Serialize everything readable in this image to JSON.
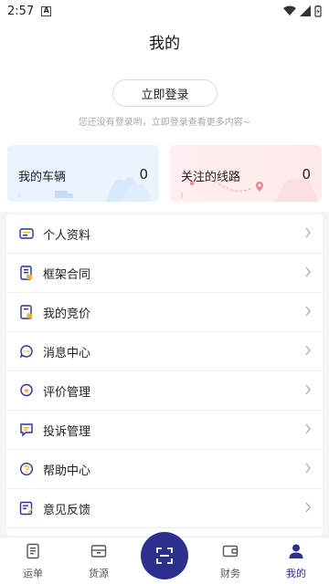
{
  "status_bar": {
    "time": "2:57",
    "notification_icon": "A"
  },
  "header": {
    "title": "我的"
  },
  "login": {
    "button_label": "立即登录",
    "hint": "您还没有登录哟，立即登录查看更多内容~"
  },
  "stats": {
    "vehicles": {
      "label": "我的车辆",
      "count": "0"
    },
    "routes": {
      "label": "关注的线路",
      "count": "0"
    }
  },
  "menu": [
    {
      "label": "个人资料",
      "icon": "id-card-icon"
    },
    {
      "label": "框架合同",
      "icon": "contract-icon"
    },
    {
      "label": "我的竞价",
      "icon": "bid-icon"
    },
    {
      "label": "消息中心",
      "icon": "message-icon"
    },
    {
      "label": "评价管理",
      "icon": "review-icon"
    },
    {
      "label": "投诉管理",
      "icon": "complaint-icon"
    },
    {
      "label": "帮助中心",
      "icon": "help-icon"
    },
    {
      "label": "意见反馈",
      "icon": "feedback-icon"
    }
  ],
  "tabbar": {
    "tabs": [
      {
        "label": "运单",
        "icon": "waybill-icon"
      },
      {
        "label": "货源",
        "icon": "cargo-icon"
      },
      {
        "label": "财务",
        "icon": "wallet-icon"
      },
      {
        "label": "我的",
        "icon": "user-icon",
        "active": true
      }
    ],
    "center_action": "scan-icon"
  },
  "colors": {
    "accent": "#2d2f8c",
    "icon_yellow": "#f0b429",
    "icon_blue": "#2e3192"
  }
}
